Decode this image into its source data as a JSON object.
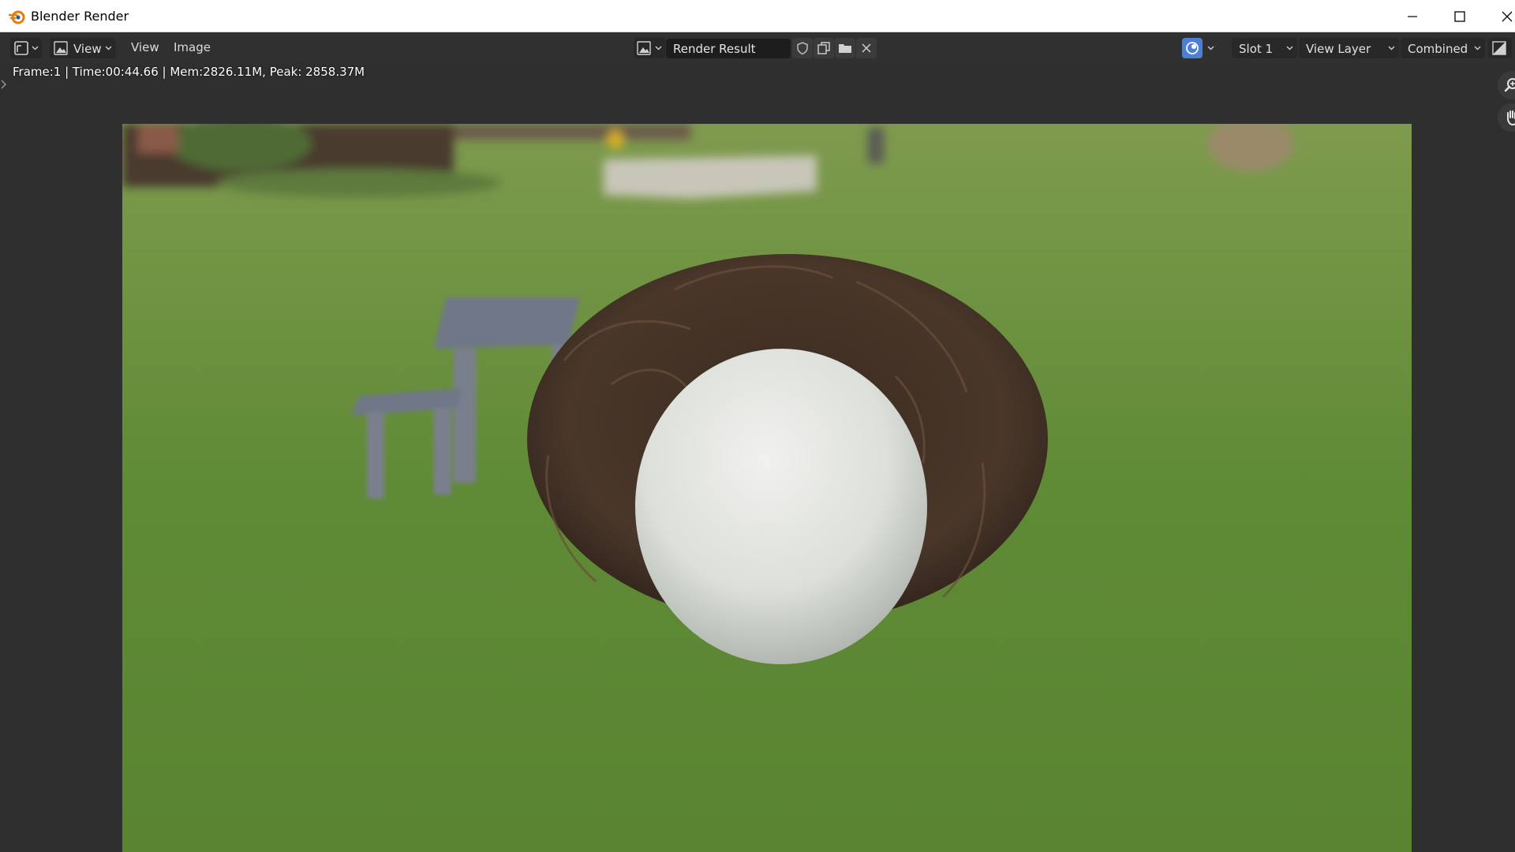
{
  "window": {
    "title": "Blender Render",
    "logo_icon": "blender-logo-icon",
    "controls": [
      "minimize-icon",
      "maximize-icon",
      "close-icon"
    ]
  },
  "header": {
    "editor_type_icon": "image-editor-icon",
    "mode_menu": {
      "icon": "image-mode-icon",
      "label": "View"
    },
    "menus": [
      "View",
      "Image"
    ],
    "image_browse_icon": "image-browse-icon",
    "image_name": "Render Result",
    "image_actions": [
      "fake-user-shield-icon",
      "duplicate-image-icon",
      "open-image-folder-icon",
      "unlink-close-icon"
    ],
    "gizmo_toggle_icon": "gizmo-toggle-icon",
    "slot": "Slot 1",
    "view_layer": "View Layer",
    "pass": "Combined",
    "display_channels_icon": "display-channels-icon"
  },
  "status": {
    "render_info": "Frame:1 | Time:00:44.66 | Mem:2826.11M, Peak: 2858.37M"
  },
  "viewport": {
    "nav_tools": [
      "zoom-icon",
      "pan-hand-icon"
    ],
    "render_subject": "render-result-image"
  },
  "colors": {
    "header_bg": "#303030",
    "viewport_bg": "#2f2f2f",
    "field_bg": "#1d1d1d",
    "accent_blue": "#4a7fd4",
    "blender_orange": "#e87d0d"
  }
}
